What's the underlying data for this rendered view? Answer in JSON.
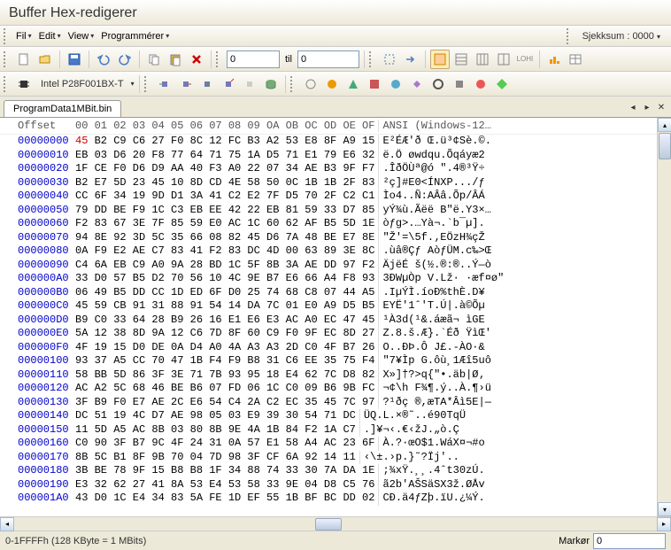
{
  "title": "Buffer Hex-redigerer",
  "menu": {
    "fil": "Fil",
    "edit": "Edit",
    "view": "View",
    "programmerer": "Programmérer"
  },
  "checksum_label": "Sjekksum : 0000",
  "input1": "0",
  "til_label": "til",
  "input2": "0",
  "device": "Intel P28F001BX-T",
  "tab_name": "ProgramData1MBit.bin",
  "header": {
    "offset": "Offset",
    "bytes": "00 01 02 03 04 05 06 07 08 09 OA OB OC OD OE OF",
    "ansi": "ANSI (Windows-12…"
  },
  "rows": [
    {
      "offset": "00000000",
      "bytes": "45 B2 C9 C6 27 F0 8C 12 FC B3 A2 53 E8 8F A9 15",
      "ansi": "E²ÉÆ'ð Œ.ü³¢Sè.©."
    },
    {
      "offset": "00000010",
      "bytes": "EB 03 D6 20 F8 77 64 71 75 1A D5 71 E1 79 E6 32",
      "ansi": "ë.Ö øwdqu.Õqáyæ2"
    },
    {
      "offset": "00000020",
      "bytes": "1F CE F0 D6 D9 AA 40 F3 A0 22 07 34 AE B3 9F F7",
      "ansi": ".ÎðÖÙª@ó \".4®³Ÿ÷"
    },
    {
      "offset": "00000030",
      "bytes": "B2 E7 5D 23 45 10 8D CD 4E 58 50 0C 1B 1B 2F 83",
      "ansi": "²ç]#E0<ÍNXP.../ƒ"
    },
    {
      "offset": "00000040",
      "bytes": "CC 6F 34 19 9D D1 3A 41 C2 E2 7F D5 70 2F C2 C1",
      "ansi": "Ìo4..Ñ:AÂâ.Õp/ÂÁ"
    },
    {
      "offset": "00000050",
      "bytes": "79 DD BE F9 1C C3 EB EE 42 22 EB 81 59 33 D7 85",
      "ansi": "yÝ¾ù.Ãëë B\"ë.Y3×…"
    },
    {
      "offset": "00000060",
      "bytes": "F2 83 67 3E 7F 85 59 E0 AC 1C 60 62 AF B5 5D 1E",
      "ansi": "òƒg>.…Yà¬.`b¯µ]."
    },
    {
      "offset": "00000070",
      "bytes": "94 8E 92 3D 5C 35 66 08 82 45 D6 7A 48 BE E7 8E",
      "ansi": "\"Ž'=\\5f.‚EÖzH¾çŽ"
    },
    {
      "offset": "00000080",
      "bytes": "0A F9 E2 AE C7 83 41 F2 83 DC 4D 00 63 89 3E 8C",
      "ansi": ".ùâ®Çƒ AòƒÜM.c‰>Œ"
    },
    {
      "offset": "00000090",
      "bytes": "C4 6A EB C9 A0 9A 28 BD 1C 5F 8B 3A AE DD 97 F2",
      "ansi": "ÄjëÉ š(½.®:®..Ý—ò"
    },
    {
      "offset": "000000A0",
      "bytes": "33 D0 57 B5 D2 70 56 10 4C 9E B7 E6 66 A4 F8 93",
      "ansi": "3ÐWµÒp V.Lž· ·æf¤ø\""
    },
    {
      "offset": "000000B0",
      "bytes": "06 49 B5 DD CC 1D ED 6F D0 25 74 68 C8 07 44 A5",
      "ansi": ".IµÝÌ.íoÐ%thÈ.D¥"
    },
    {
      "offset": "000000C0",
      "bytes": "45 59 CB 91 31 88 91 54 14 DA 7C 01 E0 A9 D5 B5",
      "ansi": "EYË'1ˆ'T.Ú|.à©Õµ"
    },
    {
      "offset": "000000D0",
      "bytes": "B9 C0 33 64 28 B9 26 16 E1 E6 E3 AC A0 EC 47 45",
      "ansi": "¹À3d(¹&.áæã¬ ìGE"
    },
    {
      "offset": "000000E0",
      "bytes": "5A 12 38 8D 9A 12 C6 7D 8F 60 C9 F0 9F EC 8D 27",
      "ansi": "Z.8.š.Æ}.`Éð ŸìŒ'"
    },
    {
      "offset": "000000F0",
      "bytes": "4F 19 15 D0 DE 0A D4 A0 4A A3 A3 2D C0 4F B7 26",
      "ansi": "O..ÐÞ.Ô J£.-ÀO·&"
    },
    {
      "offset": "00000100",
      "bytes": "93 37 A5 CC 70 47 1B F4 F9 B8 31 C6 EE 35 75 F4",
      "ansi": "\"7¥Ìp G.ôù¸1Æî5uô"
    },
    {
      "offset": "00000110",
      "bytes": "58 BB 5D 86 3F 3E 71 7B 93 95 18 E4 62 7C D8 82",
      "ansi": "X»]†?>q{\"•.äb|Ø‚"
    },
    {
      "offset": "00000120",
      "bytes": "AC A2 5C 68 46 BE B6 07 FD 06 1C C0 09 B6 9B FC",
      "ansi": "¬¢\\h F¾¶.ý..À.¶›ü"
    },
    {
      "offset": "00000130",
      "bytes": "3F B9 F0 E7 AE 2C E6 54 C4 2A C2 EC 35 45 7C 97",
      "ansi": "?¹ðç ®,æTA*Âì5E|—"
    },
    {
      "offset": "00000140",
      "bytes": "DC 51 19 4C D7 AE 98 05 03 E9 39 30 54 71 DC",
      "ansi": "ÜQ.L.×®˜..é90TqÜ"
    },
    {
      "offset": "00000150",
      "bytes": "11 5D A5 AC 8B 03 80 8B 9E 4A 1B 84 F2 1A C7",
      "ansi": ".]¥¬‹.€‹žJ.„ò.Ç"
    },
    {
      "offset": "00000160",
      "bytes": "C0 90 3F B7 9C 4F 24 31 0A 57 E1 58 A4 AC 23 6F",
      "ansi": "À.?·œO$1.WáX¤¬#o"
    },
    {
      "offset": "00000170",
      "bytes": "8B 5C B1 8F 9B 70 04 7D 98 3F CF 6A 92 14 11",
      "ansi": "‹\\±.›p.}˜?Ïj'.."
    },
    {
      "offset": "00000180",
      "bytes": "3B BE 78 9F 15 B8 B8 1F 34 88 74 33 30 7A DA 1E",
      "ansi": ";¾xŸ.¸¸.4ˆt30zÚ."
    },
    {
      "offset": "00000190",
      "bytes": "E3 32 62 27 41 8A 53 E4 53 58 33 9E 04 D8 C5 76",
      "ansi": "ã2b'AŠSäSX3ž.ØÅv"
    },
    {
      "offset": "000001A0",
      "bytes": "43 D0 1C E4 34 83 5A FE 1D EF 55 1B BF BC DD 02",
      "ansi": "CÐ.ä4ƒZþ.ïU.¿¼Ý."
    }
  ],
  "status": {
    "range": "0-1FFFFh (128 KByte = 1 MBits)",
    "cursor_label": "Markør",
    "cursor_value": "0"
  }
}
